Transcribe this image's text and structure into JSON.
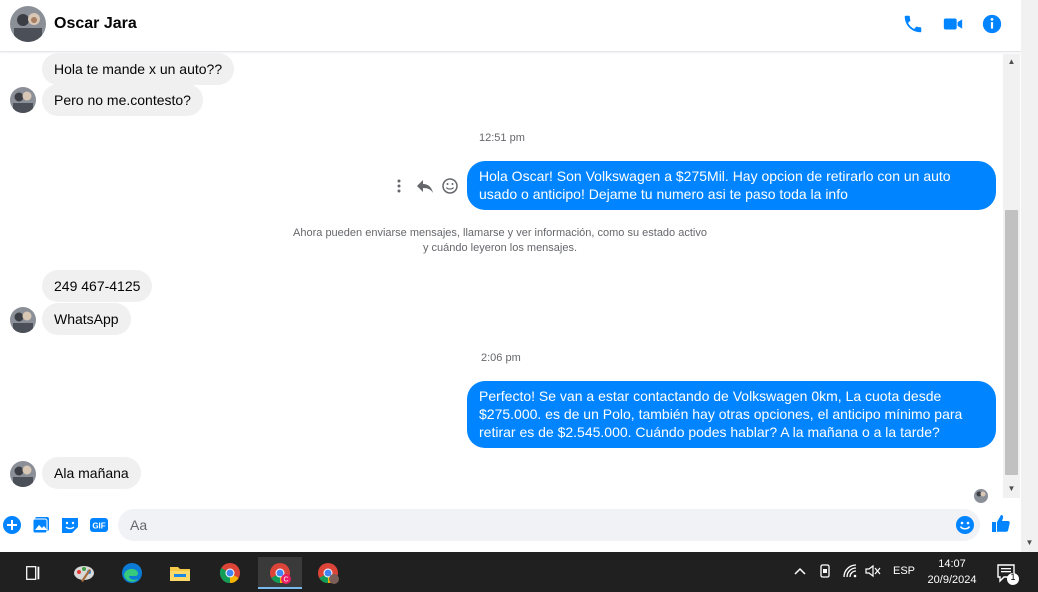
{
  "header": {
    "contact_name": "Oscar Jara"
  },
  "messages": {
    "in1": "Hola te mande x un auto??",
    "in2": "Pero no me.contesto?",
    "time1": "12:51 pm",
    "out1": "Hola Oscar! Son Volkswagen a $275Mil. Hay opcion de retirarlo con un auto usado o anticipo! Dejame tu numero asi te paso toda la info",
    "system_line1": "Ahora pueden enviarse mensajes, llamarse y ver información, como su estado activo",
    "system_line2": "y cuándo leyeron los mensajes.",
    "in3": "249 467-4125",
    "in4": "WhatsApp",
    "time2": "2:06 pm",
    "out2": "Perfecto!  Se van a estar contactando de Volkswagen 0km, La cuota desde $275.000. es de un Polo, también hay otras opciones, el anticipo mínimo para retirar es de $2.545.000. Cuándo podes hablar? A la mañana o a la tarde?",
    "in5": "Ala mañana"
  },
  "composer": {
    "placeholder": "Aa"
  },
  "taskbar": {
    "language": "ESP",
    "time": "14:07",
    "date": "20/9/2024",
    "notification_count": "1"
  },
  "colors": {
    "accent": "#0084ff",
    "incoming_bubble": "#f0f0f0",
    "taskbar": "#202020"
  }
}
